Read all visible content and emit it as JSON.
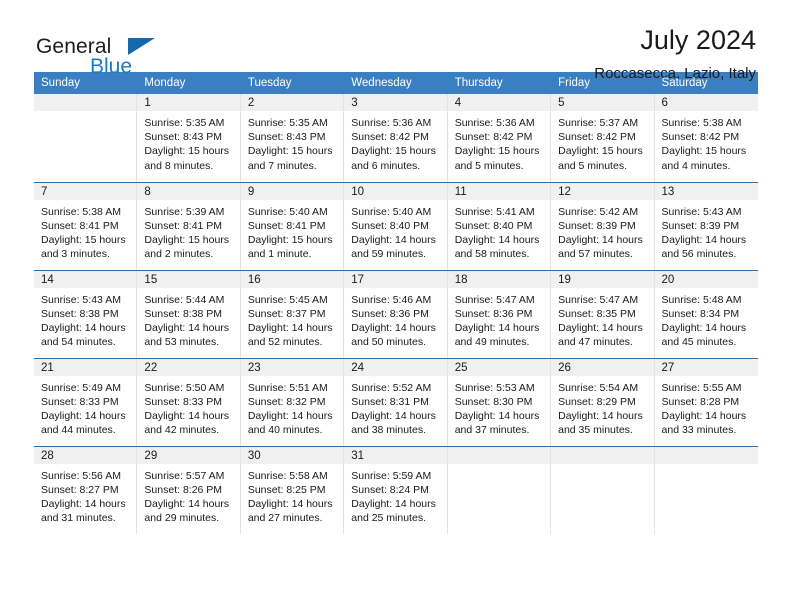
{
  "brand": {
    "name_top": "General",
    "name_bottom": "Blue",
    "triangle_color": "#1769ad",
    "blue_color": "#1f7ac4"
  },
  "header": {
    "title": "July 2024",
    "subtitle": "Roccasecca, Lazio, Italy"
  },
  "theme": {
    "header_row_bg": "#3a7fc1",
    "header_row_text": "#ffffff",
    "daynum_band_bg": "#f0f0f0",
    "week_divider": "#2e6da4",
    "cell_divider": "#e3e3e3"
  },
  "weekday_headers": [
    "Sunday",
    "Monday",
    "Tuesday",
    "Wednesday",
    "Thursday",
    "Friday",
    "Saturday"
  ],
  "weeks": [
    {
      "days": [
        {
          "date": "",
          "lines": []
        },
        {
          "date": "1",
          "lines": [
            "Sunrise: 5:35 AM",
            "Sunset: 8:43 PM",
            "Daylight: 15 hours",
            "and 8 minutes."
          ]
        },
        {
          "date": "2",
          "lines": [
            "Sunrise: 5:35 AM",
            "Sunset: 8:43 PM",
            "Daylight: 15 hours",
            "and 7 minutes."
          ]
        },
        {
          "date": "3",
          "lines": [
            "Sunrise: 5:36 AM",
            "Sunset: 8:42 PM",
            "Daylight: 15 hours",
            "and 6 minutes."
          ]
        },
        {
          "date": "4",
          "lines": [
            "Sunrise: 5:36 AM",
            "Sunset: 8:42 PM",
            "Daylight: 15 hours",
            "and 5 minutes."
          ]
        },
        {
          "date": "5",
          "lines": [
            "Sunrise: 5:37 AM",
            "Sunset: 8:42 PM",
            "Daylight: 15 hours",
            "and 5 minutes."
          ]
        },
        {
          "date": "6",
          "lines": [
            "Sunrise: 5:38 AM",
            "Sunset: 8:42 PM",
            "Daylight: 15 hours",
            "and 4 minutes."
          ]
        }
      ]
    },
    {
      "days": [
        {
          "date": "7",
          "lines": [
            "Sunrise: 5:38 AM",
            "Sunset: 8:41 PM",
            "Daylight: 15 hours",
            "and 3 minutes."
          ]
        },
        {
          "date": "8",
          "lines": [
            "Sunrise: 5:39 AM",
            "Sunset: 8:41 PM",
            "Daylight: 15 hours",
            "and 2 minutes."
          ]
        },
        {
          "date": "9",
          "lines": [
            "Sunrise: 5:40 AM",
            "Sunset: 8:41 PM",
            "Daylight: 15 hours",
            "and 1 minute."
          ]
        },
        {
          "date": "10",
          "lines": [
            "Sunrise: 5:40 AM",
            "Sunset: 8:40 PM",
            "Daylight: 14 hours",
            "and 59 minutes."
          ]
        },
        {
          "date": "11",
          "lines": [
            "Sunrise: 5:41 AM",
            "Sunset: 8:40 PM",
            "Daylight: 14 hours",
            "and 58 minutes."
          ]
        },
        {
          "date": "12",
          "lines": [
            "Sunrise: 5:42 AM",
            "Sunset: 8:39 PM",
            "Daylight: 14 hours",
            "and 57 minutes."
          ]
        },
        {
          "date": "13",
          "lines": [
            "Sunrise: 5:43 AM",
            "Sunset: 8:39 PM",
            "Daylight: 14 hours",
            "and 56 minutes."
          ]
        }
      ]
    },
    {
      "days": [
        {
          "date": "14",
          "lines": [
            "Sunrise: 5:43 AM",
            "Sunset: 8:38 PM",
            "Daylight: 14 hours",
            "and 54 minutes."
          ]
        },
        {
          "date": "15",
          "lines": [
            "Sunrise: 5:44 AM",
            "Sunset: 8:38 PM",
            "Daylight: 14 hours",
            "and 53 minutes."
          ]
        },
        {
          "date": "16",
          "lines": [
            "Sunrise: 5:45 AM",
            "Sunset: 8:37 PM",
            "Daylight: 14 hours",
            "and 52 minutes."
          ]
        },
        {
          "date": "17",
          "lines": [
            "Sunrise: 5:46 AM",
            "Sunset: 8:36 PM",
            "Daylight: 14 hours",
            "and 50 minutes."
          ]
        },
        {
          "date": "18",
          "lines": [
            "Sunrise: 5:47 AM",
            "Sunset: 8:36 PM",
            "Daylight: 14 hours",
            "and 49 minutes."
          ]
        },
        {
          "date": "19",
          "lines": [
            "Sunrise: 5:47 AM",
            "Sunset: 8:35 PM",
            "Daylight: 14 hours",
            "and 47 minutes."
          ]
        },
        {
          "date": "20",
          "lines": [
            "Sunrise: 5:48 AM",
            "Sunset: 8:34 PM",
            "Daylight: 14 hours",
            "and 45 minutes."
          ]
        }
      ]
    },
    {
      "days": [
        {
          "date": "21",
          "lines": [
            "Sunrise: 5:49 AM",
            "Sunset: 8:33 PM",
            "Daylight: 14 hours",
            "and 44 minutes."
          ]
        },
        {
          "date": "22",
          "lines": [
            "Sunrise: 5:50 AM",
            "Sunset: 8:33 PM",
            "Daylight: 14 hours",
            "and 42 minutes."
          ]
        },
        {
          "date": "23",
          "lines": [
            "Sunrise: 5:51 AM",
            "Sunset: 8:32 PM",
            "Daylight: 14 hours",
            "and 40 minutes."
          ]
        },
        {
          "date": "24",
          "lines": [
            "Sunrise: 5:52 AM",
            "Sunset: 8:31 PM",
            "Daylight: 14 hours",
            "and 38 minutes."
          ]
        },
        {
          "date": "25",
          "lines": [
            "Sunrise: 5:53 AM",
            "Sunset: 8:30 PM",
            "Daylight: 14 hours",
            "and 37 minutes."
          ]
        },
        {
          "date": "26",
          "lines": [
            "Sunrise: 5:54 AM",
            "Sunset: 8:29 PM",
            "Daylight: 14 hours",
            "and 35 minutes."
          ]
        },
        {
          "date": "27",
          "lines": [
            "Sunrise: 5:55 AM",
            "Sunset: 8:28 PM",
            "Daylight: 14 hours",
            "and 33 minutes."
          ]
        }
      ]
    },
    {
      "days": [
        {
          "date": "28",
          "lines": [
            "Sunrise: 5:56 AM",
            "Sunset: 8:27 PM",
            "Daylight: 14 hours",
            "and 31 minutes."
          ]
        },
        {
          "date": "29",
          "lines": [
            "Sunrise: 5:57 AM",
            "Sunset: 8:26 PM",
            "Daylight: 14 hours",
            "and 29 minutes."
          ]
        },
        {
          "date": "30",
          "lines": [
            "Sunrise: 5:58 AM",
            "Sunset: 8:25 PM",
            "Daylight: 14 hours",
            "and 27 minutes."
          ]
        },
        {
          "date": "31",
          "lines": [
            "Sunrise: 5:59 AM",
            "Sunset: 8:24 PM",
            "Daylight: 14 hours",
            "and 25 minutes."
          ]
        },
        {
          "date": "",
          "lines": []
        },
        {
          "date": "",
          "lines": []
        },
        {
          "date": "",
          "lines": []
        }
      ]
    }
  ]
}
